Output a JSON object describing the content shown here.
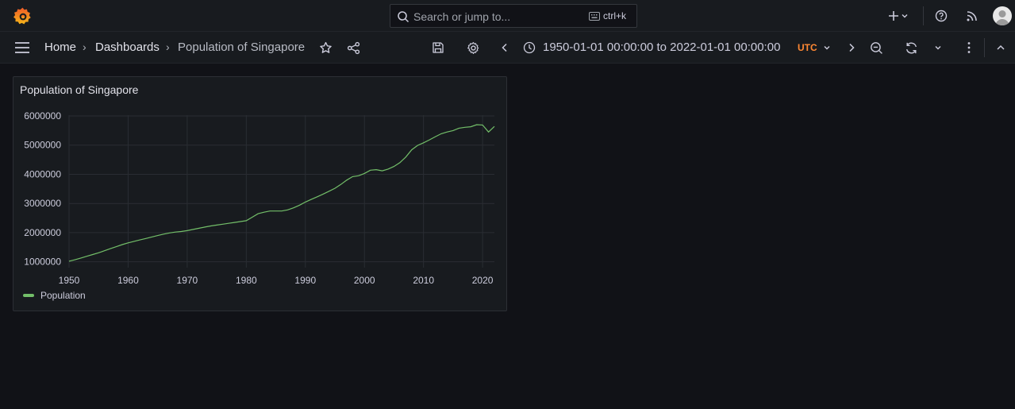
{
  "topbar": {
    "search_placeholder": "Search or jump to...",
    "search_shortcut": "ctrl+k",
    "icons": [
      "grafana-logo-icon",
      "add-icon",
      "help-icon",
      "news-icon",
      "avatar"
    ]
  },
  "navbar": {
    "breadcrumb": [
      "Home",
      "Dashboards",
      "Population of Singapore"
    ],
    "separator": "›",
    "time_range": "1950-01-01 00:00:00 to 2022-01-01 00:00:00",
    "timezone": "UTC"
  },
  "panel": {
    "title": "Population of Singapore"
  },
  "colors": {
    "background": "#111217",
    "panel": "#181b1f",
    "series": "#73bf69",
    "timezone": "#ff8833"
  },
  "chart_data": {
    "type": "line",
    "title": "Population of Singapore",
    "x_ticks": [
      "1950",
      "1960",
      "1970",
      "1980",
      "1990",
      "2000",
      "2010",
      "2020"
    ],
    "y_ticks": [
      "1000000",
      "2000000",
      "3000000",
      "4000000",
      "5000000",
      "6000000"
    ],
    "xlim": [
      1950,
      2022
    ],
    "ylim": [
      800000,
      6300000
    ],
    "grid": true,
    "legend_position": "bottom-left",
    "series": [
      {
        "name": "Population",
        "x": [
          1950,
          1951,
          1952,
          1953,
          1954,
          1955,
          1956,
          1957,
          1958,
          1959,
          1960,
          1961,
          1962,
          1963,
          1964,
          1965,
          1966,
          1967,
          1968,
          1969,
          1970,
          1971,
          1972,
          1973,
          1974,
          1975,
          1976,
          1977,
          1978,
          1979,
          1980,
          1981,
          1982,
          1983,
          1984,
          1985,
          1986,
          1987,
          1988,
          1989,
          1990,
          1991,
          1992,
          1993,
          1994,
          1995,
          1996,
          1997,
          1998,
          1999,
          2000,
          2001,
          2002,
          2003,
          2004,
          2005,
          2006,
          2007,
          2008,
          2009,
          2010,
          2011,
          2012,
          2013,
          2014,
          2015,
          2016,
          2017,
          2018,
          2019,
          2020,
          2021,
          2022
        ],
        "y": [
          1020000,
          1070000,
          1130000,
          1190000,
          1250000,
          1310000,
          1380000,
          1450000,
          1520000,
          1590000,
          1650000,
          1700000,
          1750000,
          1800000,
          1850000,
          1900000,
          1950000,
          1990000,
          2020000,
          2040000,
          2070000,
          2110000,
          2150000,
          2190000,
          2230000,
          2260000,
          2290000,
          2320000,
          2350000,
          2380000,
          2410000,
          2530000,
          2650000,
          2700000,
          2740000,
          2740000,
          2740000,
          2780000,
          2850000,
          2940000,
          3050000,
          3140000,
          3230000,
          3320000,
          3420000,
          3520000,
          3650000,
          3800000,
          3920000,
          3950000,
          4030000,
          4140000,
          4160000,
          4120000,
          4180000,
          4270000,
          4400000,
          4590000,
          4840000,
          4990000,
          5080000,
          5180000,
          5290000,
          5390000,
          5450000,
          5500000,
          5580000,
          5610000,
          5630000,
          5700000,
          5690000,
          5450000,
          5640000
        ]
      }
    ]
  }
}
